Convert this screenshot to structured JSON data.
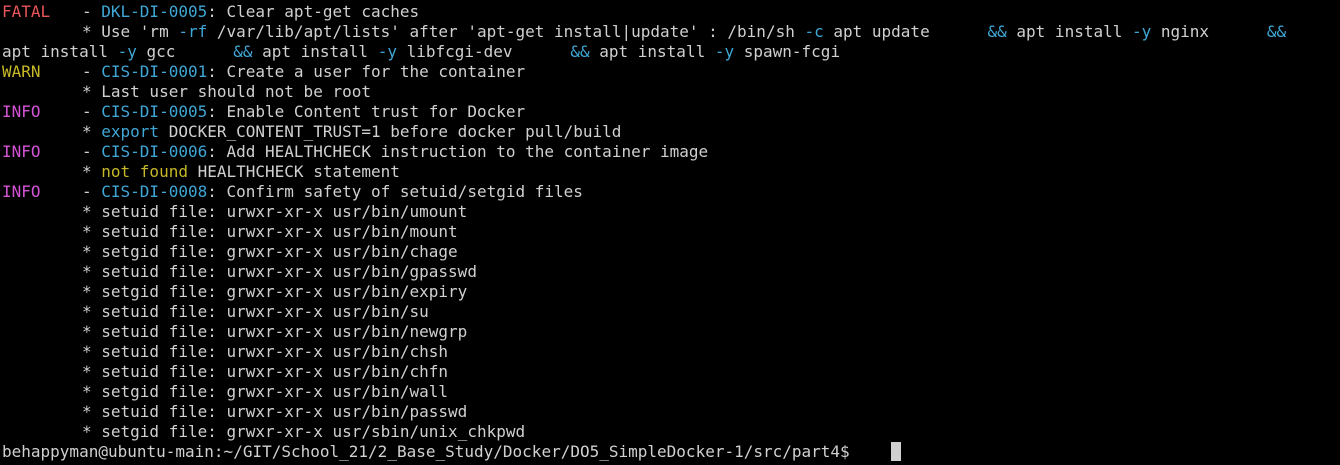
{
  "terminal": {
    "cropped_top_fragment": "(partially cut-off line above)",
    "entries": {
      "fatal": {
        "level": "FATAL",
        "code": "DKL-DI-0005",
        "title": ": Clear apt-get caches",
        "detail_1_pre": "* Use 'rm ",
        "detail_1_flag_rf": "-rf",
        "detail_1_mid": " /var/lib/apt/lists' after 'apt-get install|update' : /bin/sh ",
        "detail_1_flag_c": "-c",
        "detail_1_cmd1": " apt update      ",
        "detail_1_and1": "&&",
        "detail_1_cmd2": " apt install ",
        "detail_1_flag_y1": "-y",
        "detail_1_cmd3": " nginx      ",
        "detail_1_and2": "&&",
        "detail_2_cmd1": "apt install ",
        "detail_2_flag_y2": "-y",
        "detail_2_cmd2": " gcc      ",
        "detail_2_and3": "&&",
        "detail_2_cmd3": " apt install ",
        "detail_2_flag_y3": "-y",
        "detail_2_cmd4": " libfcgi-dev      ",
        "detail_2_and4": "&&",
        "detail_2_cmd5": " apt install ",
        "detail_2_flag_y4": "-y",
        "detail_2_cmd6": " spawn-fcgi"
      },
      "warn": {
        "level": "WARN",
        "code": "CIS-DI-0001",
        "title": ": Create a user for the container",
        "detail": "* Last user should not be root"
      },
      "info_trust": {
        "level": "INFO",
        "code": "CIS-DI-0005",
        "title": ": Enable Content trust for Docker",
        "detail_bullet": "* ",
        "detail_kw": "export",
        "detail_rest": " DOCKER_CONTENT_TRUST=1 before docker pull/build"
      },
      "info_healthcheck": {
        "level": "INFO",
        "code": "CIS-DI-0006",
        "title": ": Add HEALTHCHECK instruction to the container image",
        "detail_bullet": "* ",
        "detail_kw": "not found",
        "detail_rest": " HEALTHCHECK statement"
      },
      "info_setuid": {
        "level": "INFO",
        "code": "CIS-DI-0008",
        "title": ": Confirm safety of setuid/setgid files",
        "files": [
          "* setuid file: urwxr-xr-x usr/bin/umount",
          "* setuid file: urwxr-xr-x usr/bin/mount",
          "* setgid file: grwxr-xr-x usr/bin/chage",
          "* setuid file: urwxr-xr-x usr/bin/gpasswd",
          "* setgid file: grwxr-xr-x usr/bin/expiry",
          "* setuid file: urwxr-xr-x usr/bin/su",
          "* setuid file: urwxr-xr-x usr/bin/newgrp",
          "* setuid file: urwxr-xr-x usr/bin/chsh",
          "* setuid file: urwxr-xr-x usr/bin/chfn",
          "* setgid file: grwxr-xr-x usr/bin/wall",
          "* setuid file: urwxr-xr-x usr/bin/passwd",
          "* setgid file: grwxr-xr-x usr/sbin/unix_chkpwd"
        ]
      }
    },
    "dash": "- ",
    "prompt": "behappyman@ubuntu-main:~/GIT/School_21/2_Base_Study/Docker/DO5_SimpleDocker-1/src/part4$ "
  },
  "colors": {
    "background": "#000000",
    "text": "#d0d0d0",
    "fatal": "#e8555a",
    "warn": "#c6b829",
    "info": "#d255d6",
    "code_link": "#3fa7d6",
    "highlight_yellow": "#c6b829"
  }
}
